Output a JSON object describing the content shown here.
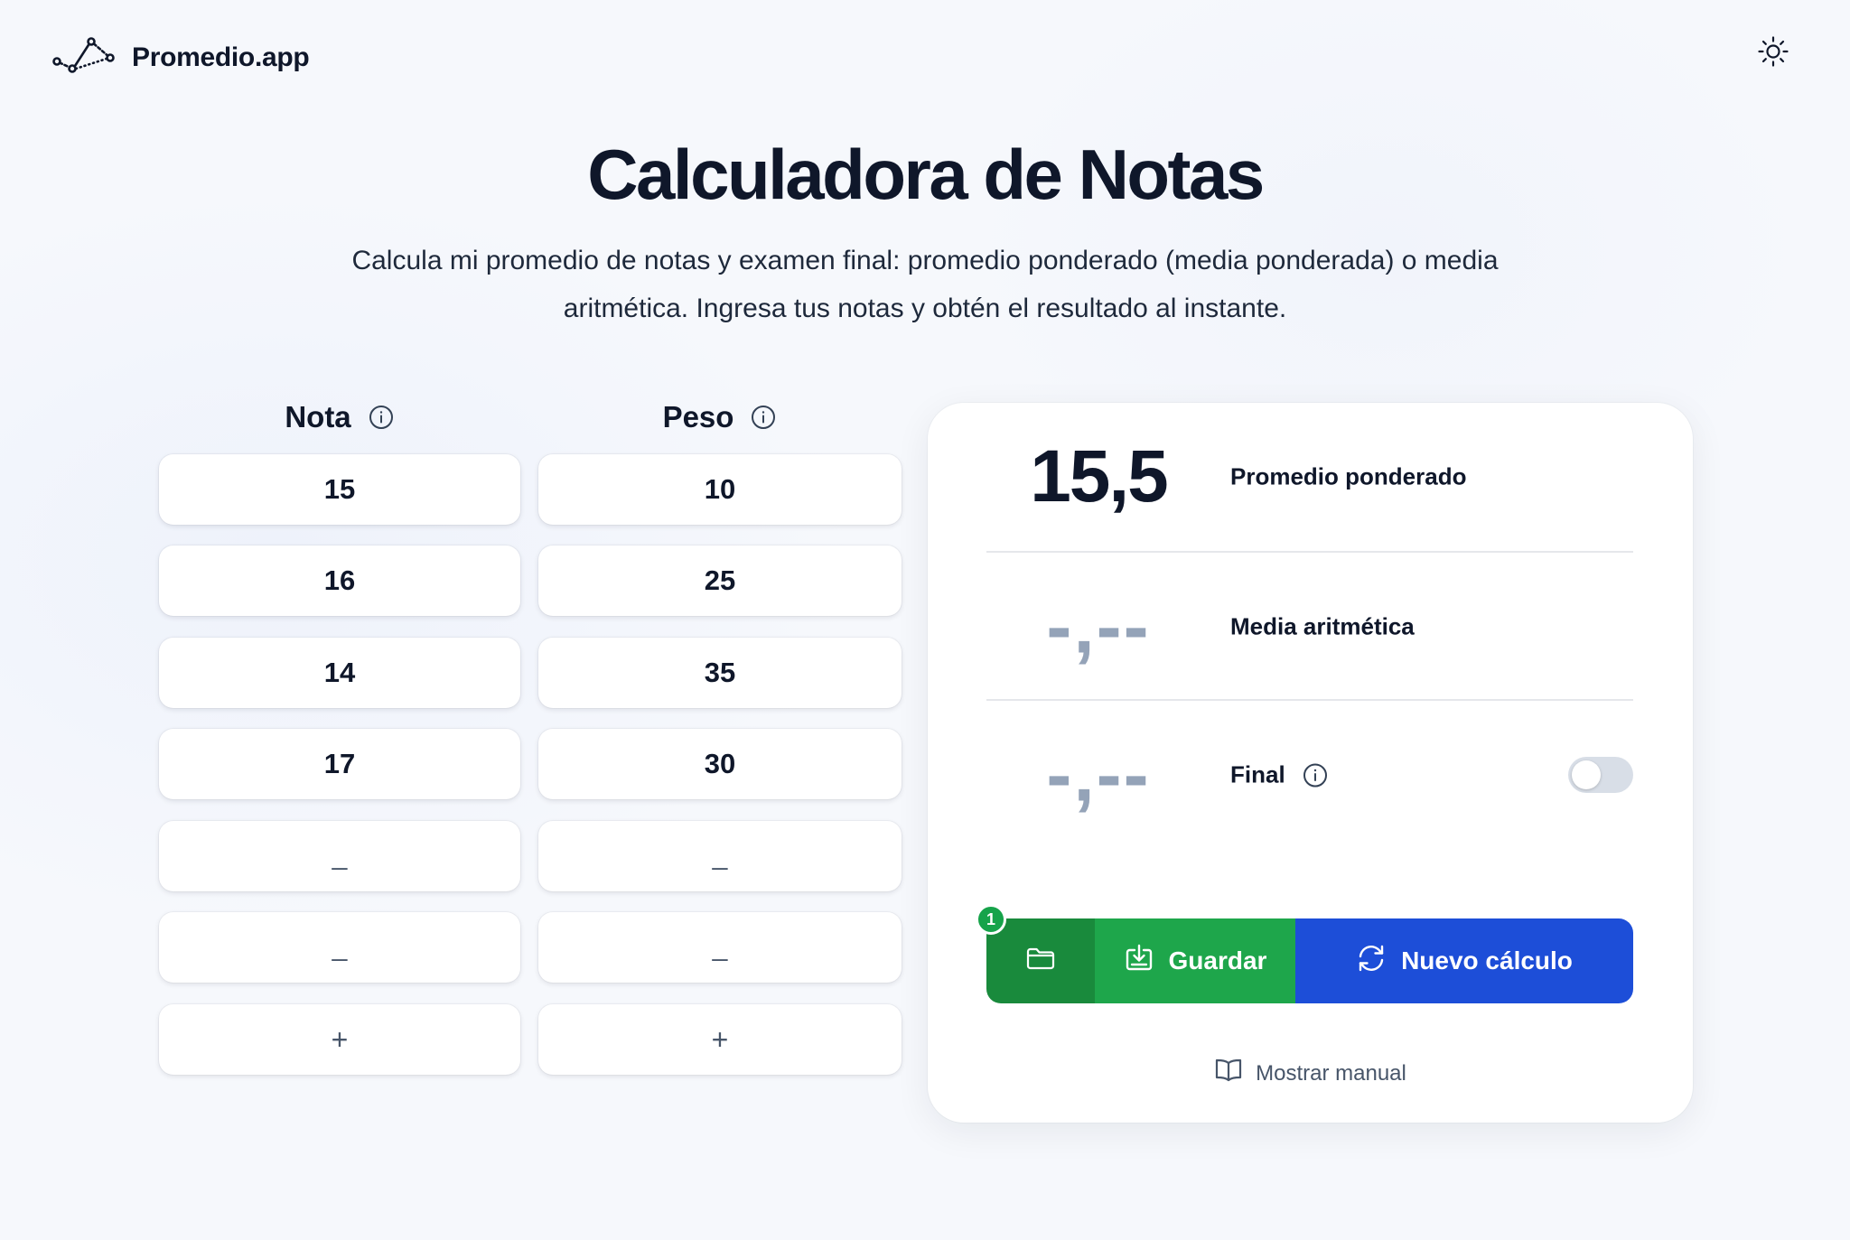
{
  "app": {
    "name": "Promedio.app"
  },
  "hero": {
    "title": "Calculadora de Notas",
    "subtitle_line1": "Calcula mi promedio de notas y examen final: promedio ponderado (media ponderada) o media",
    "subtitle_line2": "aritmética. Ingresa tus notas y obtén el resultado al instante."
  },
  "table": {
    "nota_header": "Nota",
    "peso_header": "Peso",
    "rows": [
      {
        "nota": "15",
        "peso": "10"
      },
      {
        "nota": "16",
        "peso": "25"
      },
      {
        "nota": "14",
        "peso": "35"
      },
      {
        "nota": "17",
        "peso": "30"
      },
      {
        "nota": "_",
        "peso": "_"
      },
      {
        "nota": "_",
        "peso": "_"
      }
    ],
    "add_label": "+"
  },
  "results": {
    "weighted_value": "15,5",
    "weighted_label": "Promedio ponderado",
    "arithmetic_value": "-,--",
    "arithmetic_label": "Media aritmética",
    "final_value": "-,--",
    "final_label": "Final",
    "final_toggle_on": false
  },
  "actions": {
    "badge_count": "1",
    "save_label": "Guardar",
    "new_label": "Nuevo cálculo",
    "manual_label": "Mostrar manual"
  },
  "icons": {
    "logo": "line-chart-logo-icon",
    "theme": "sun-icon",
    "info": "info-icon",
    "folder": "folder-icon",
    "save": "download-icon",
    "new": "refresh-icon",
    "manual": "book-icon"
  },
  "colors": {
    "accent_green": "#1ea64b",
    "accent_green_dark": "#198a3c",
    "accent_blue": "#1d4ed8",
    "text": "#0f172a",
    "muted": "#94a3b8"
  }
}
